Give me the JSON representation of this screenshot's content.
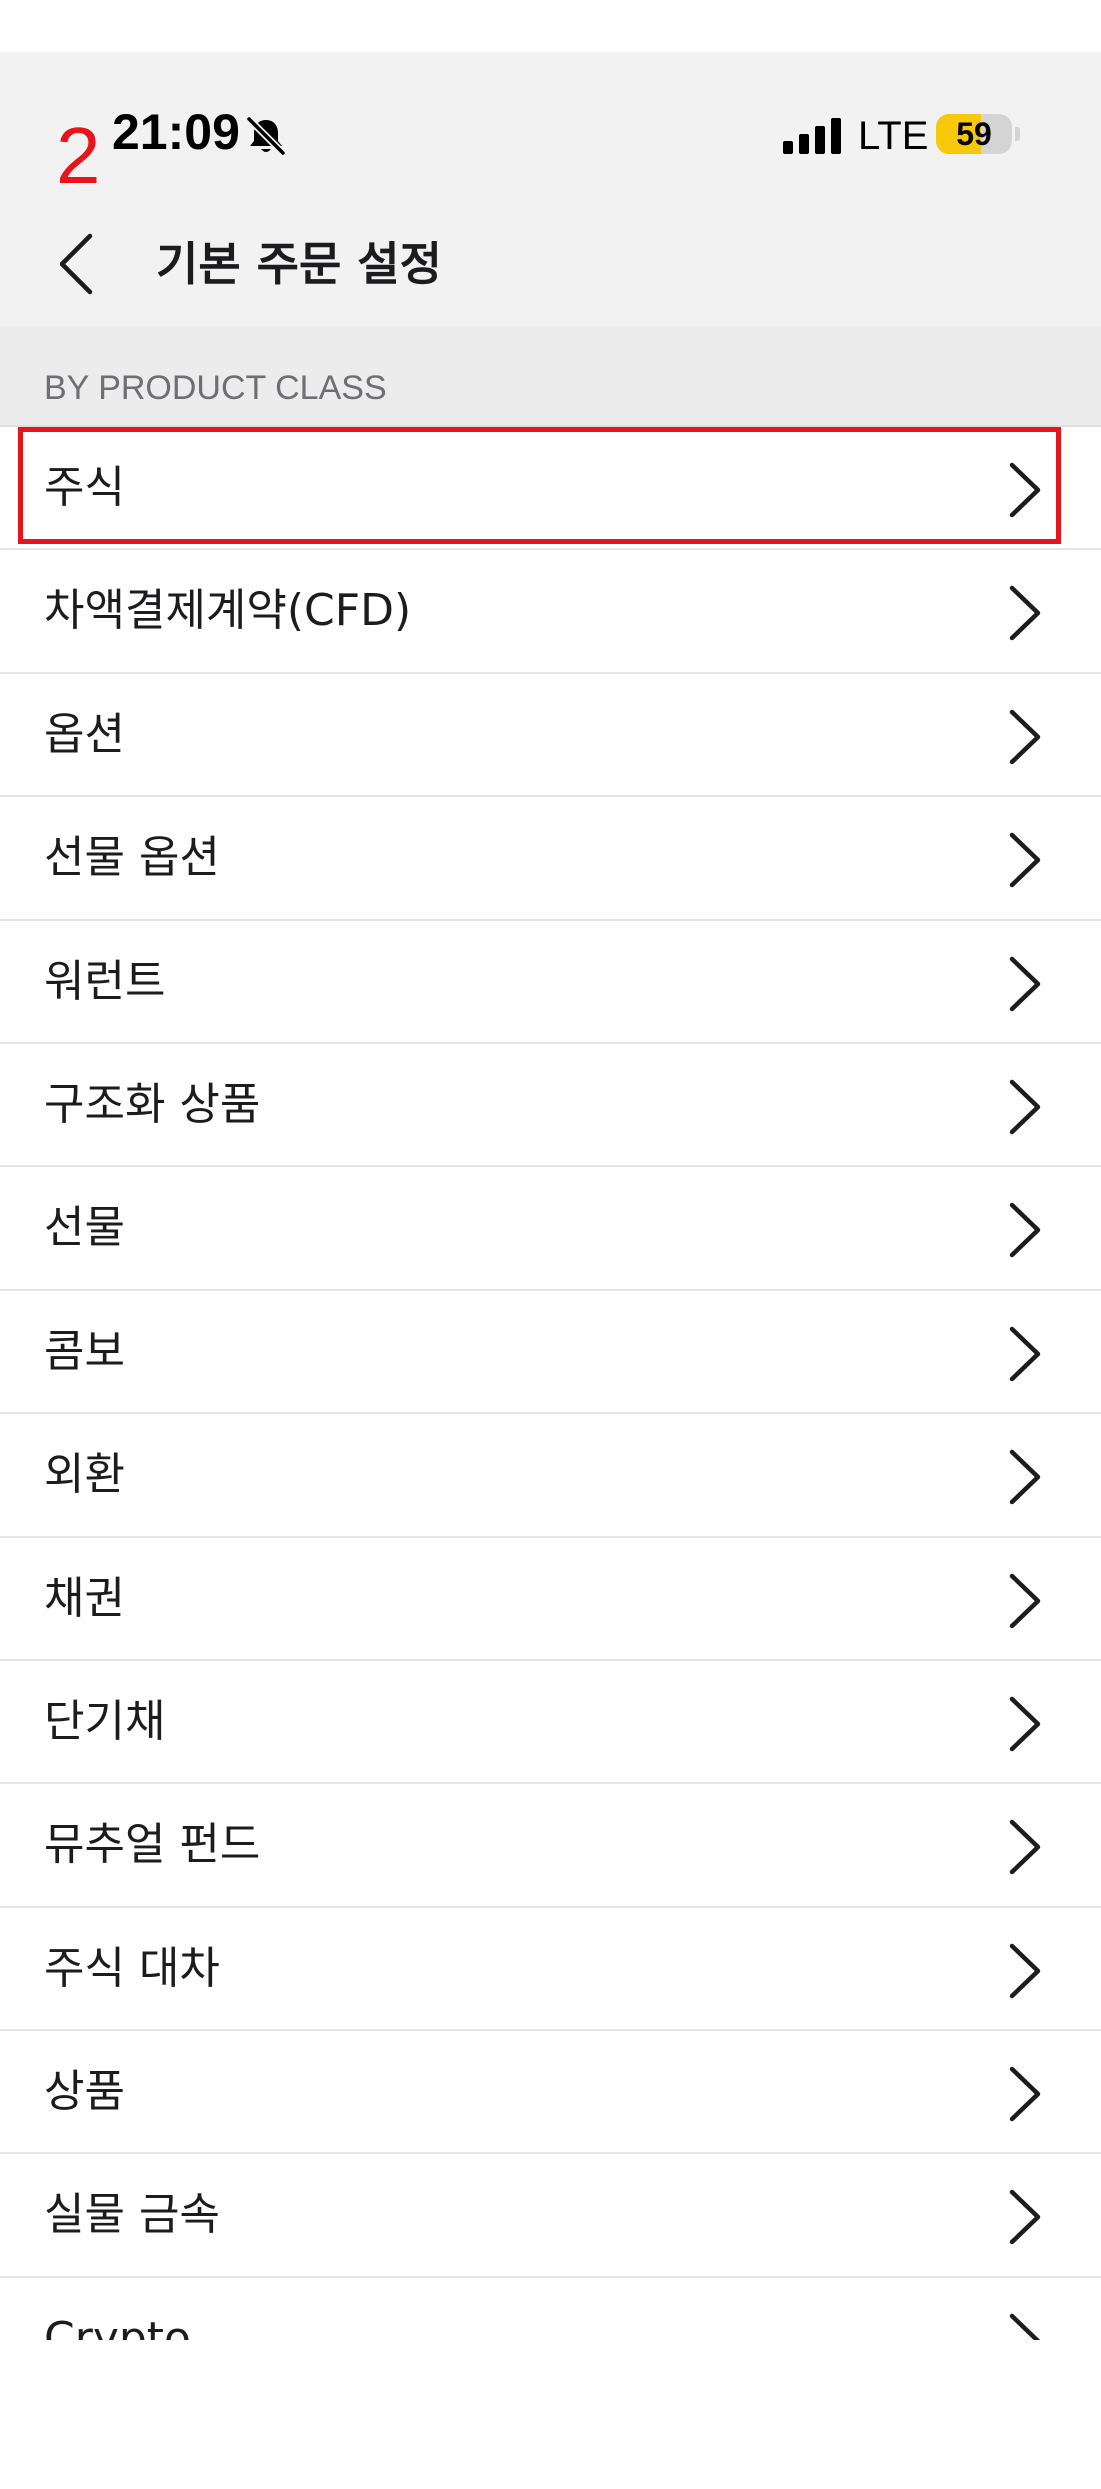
{
  "annotation": {
    "step_number": "2",
    "color": "#e8141c"
  },
  "status_bar": {
    "time": "21:09",
    "bell_icon": "bell-slash-icon",
    "signal_icon": "cellular-signal-icon",
    "network": "LTE",
    "battery_percent": "59",
    "battery_level": 0.59,
    "battery_color": "#f7c90a"
  },
  "nav": {
    "back_icon": "chevron-left-icon",
    "title": "기본 주문 설정"
  },
  "section": {
    "label": "BY PRODUCT CLASS"
  },
  "items": [
    {
      "label": "주식",
      "highlighted": true
    },
    {
      "label": "차액결제계약(CFD)"
    },
    {
      "label": "옵션"
    },
    {
      "label": "선물 옵션"
    },
    {
      "label": "워런트"
    },
    {
      "label": "구조화 상품"
    },
    {
      "label": "선물"
    },
    {
      "label": "콤보"
    },
    {
      "label": "외환"
    },
    {
      "label": "채권"
    },
    {
      "label": "단기채"
    },
    {
      "label": "뮤추얼 펀드"
    },
    {
      "label": "주식 대차"
    },
    {
      "label": "상품"
    },
    {
      "label": "실물 금속"
    },
    {
      "label": "Crypto"
    }
  ],
  "item_icon": "chevron-right-icon"
}
